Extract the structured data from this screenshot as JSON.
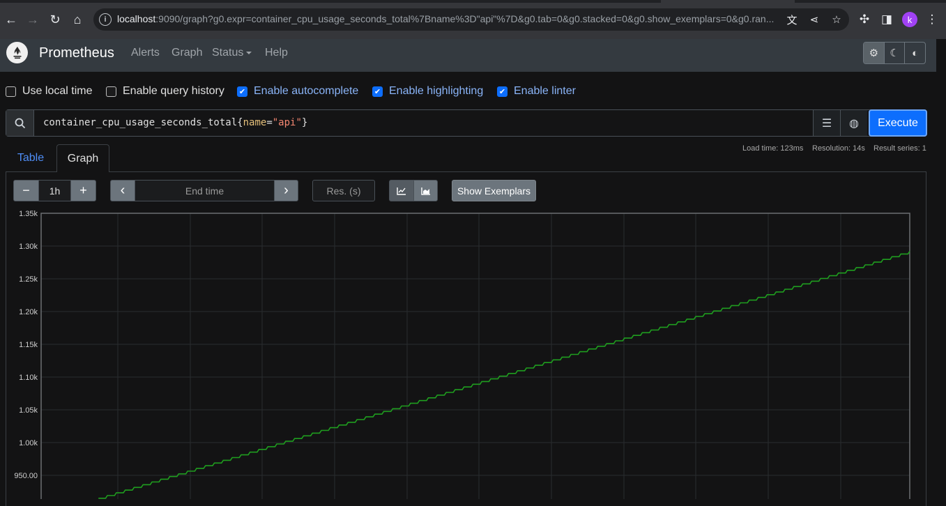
{
  "browser": {
    "url_host": "localhost",
    "url_rest": ":9090/graph?g0.expr=container_cpu_usage_seconds_total%7Bname%3D\"api\"%7D&g0.tab=0&g0.stacked=0&g0.show_exemplars=0&g0.ran...",
    "profile_initial": "k"
  },
  "navbar": {
    "brand": "Prometheus",
    "links": [
      "Alerts",
      "Graph",
      "Status",
      "Help"
    ]
  },
  "options": [
    {
      "label": "Use local time",
      "checked": false
    },
    {
      "label": "Enable query history",
      "checked": false
    },
    {
      "label": "Enable autocomplete",
      "checked": true
    },
    {
      "label": "Enable highlighting",
      "checked": true
    },
    {
      "label": "Enable linter",
      "checked": true
    }
  ],
  "query": {
    "metric": "container_cpu_usage_seconds_total",
    "open_brace": "{",
    "label_name": "name",
    "equals": "=",
    "label_value": "\"api\"",
    "close_brace": "}",
    "execute_label": "Execute"
  },
  "stats": {
    "load_time": "Load time: 123ms",
    "resolution": "Resolution: 14s",
    "result_series": "Result series: 1"
  },
  "tabs": {
    "table": "Table",
    "graph": "Graph"
  },
  "controls": {
    "minus": "−",
    "range": "1h",
    "plus": "+",
    "prev": "‹",
    "end_time_placeholder": "End time",
    "next": "›",
    "resolution_placeholder": "Res. (s)",
    "show_exemplars": "Show Exemplars"
  },
  "chart_data": {
    "type": "line",
    "title": "",
    "xlabel": "",
    "ylabel": "",
    "yticks": [
      "1.35k",
      "1.30k",
      "1.25k",
      "1.20k",
      "1.15k",
      "1.10k",
      "1.05k",
      "1.00k",
      "950.00"
    ],
    "ylim_visible": [
      915,
      1350
    ],
    "grid": true,
    "series": [
      {
        "color": "#1f9e1f",
        "style": "staircase",
        "x_fraction_start": 0.066,
        "x_fraction_end": 1.0,
        "y_start": 915,
        "y_end": 1292,
        "steps": 91
      }
    ]
  }
}
